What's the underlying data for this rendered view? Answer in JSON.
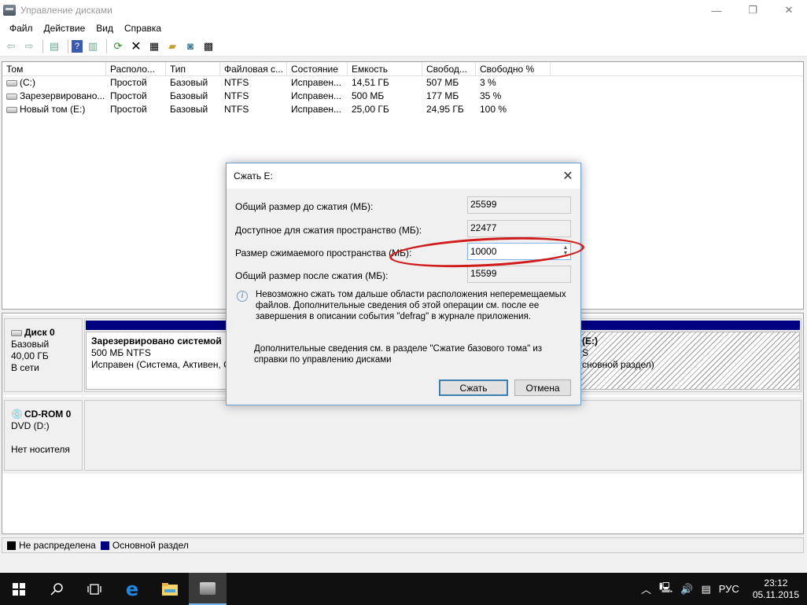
{
  "window": {
    "title": "Управление дисками",
    "controls": {
      "minimize": "—",
      "restore": "❐",
      "close": "✕"
    }
  },
  "menu": [
    "Файл",
    "Действие",
    "Вид",
    "Справка"
  ],
  "toolbar": {
    "icons": [
      "back-icon",
      "forward-icon",
      "console-tree-icon",
      "help-icon",
      "properties-pane-icon",
      "refresh-icon",
      "delete-icon",
      "properties-icon",
      "open-icon",
      "explore-icon",
      "settings-icon"
    ]
  },
  "volume_list": {
    "columns": [
      "Том",
      "Располо...",
      "Тип",
      "Файловая с...",
      "Состояние",
      "Емкость",
      "Свобод...",
      "Свободно %"
    ],
    "rows": [
      [
        "(C:)",
        "Простой",
        "Базовый",
        "NTFS",
        "Исправен...",
        "14,51 ГБ",
        "507 МБ",
        "3 %"
      ],
      [
        "Зарезервировано...",
        "Простой",
        "Базовый",
        "NTFS",
        "Исправен...",
        "500 МБ",
        "177 МБ",
        "35 %"
      ],
      [
        "Новый том (E:)",
        "Простой",
        "Базовый",
        "NTFS",
        "Исправен...",
        "25,00 ГБ",
        "24,95 ГБ",
        "100 %"
      ]
    ]
  },
  "disks": [
    {
      "name": "Диск 0",
      "type": "Базовый",
      "size": "40,00 ГБ",
      "status": "В сети",
      "partitions": [
        {
          "name": "Зарезервировано системой",
          "info": "500 МБ NTFS",
          "status": "Исправен (Система, Активен, С"
        },
        {
          "name": "(E:)",
          "info": "S",
          "status": "сновной раздел)"
        }
      ]
    },
    {
      "name": "CD-ROM 0",
      "type": "DVD (D:)",
      "status": "Нет носителя"
    }
  ],
  "legend": [
    {
      "label": "Не распределена",
      "color": "#000000"
    },
    {
      "label": "Основной раздел",
      "color": "#000080"
    }
  ],
  "dialog": {
    "title": "Сжать E:",
    "fields": [
      {
        "label": "Общий размер до сжатия (МБ):",
        "value": "25599"
      },
      {
        "label": "Доступное для сжатия пространство (МБ):",
        "value": "22477"
      },
      {
        "label": "Размер сжимаемого пространства (МБ):",
        "value": "10000"
      },
      {
        "label": "Общий размер после сжатия (МБ):",
        "value": "15599"
      }
    ],
    "info": "Невозможно сжать том дальше области расположения неперемещаемых файлов. Дополнительные сведения об этой операции см. после ее завершения в описании события \"defrag\" в журнале приложения.",
    "help": "Дополнительные сведения см. в разделе \"Сжатие базового тома\" из справки по управлению дисками",
    "shrink_button": "Сжать",
    "cancel_button": "Отмена"
  },
  "taskbar": {
    "tray": {
      "language": "РУС",
      "time": "23:12",
      "date": "05.11.2015"
    }
  },
  "colors": {
    "primary_partition": "#000080",
    "annotation": "#d11a1a"
  }
}
